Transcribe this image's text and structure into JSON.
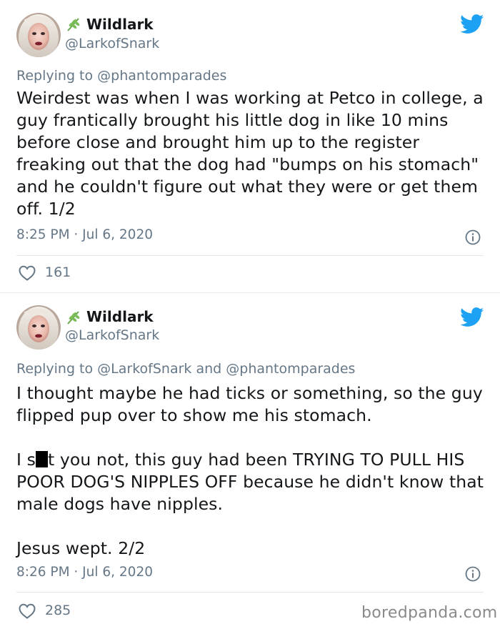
{
  "tweets": [
    {
      "author": {
        "name": "Wildlark",
        "handle": "@LarkofSnark"
      },
      "reply": {
        "prefix": "Replying to",
        "mentions": [
          "@phantomparades"
        ],
        "joiner": ""
      },
      "body": "Weirdest was when I was working at Petco in college, a guy frantically brought his little dog in like 10 mins before close and brought him up to the register freaking out that the dog had \"bumps on his stomach\" and he couldn't figure out what they were or get them off. 1/2",
      "timestamp": "8:25 PM · Jul 6, 2020",
      "likes": "161"
    },
    {
      "author": {
        "name": "Wildlark",
        "handle": "@LarkofSnark"
      },
      "reply": {
        "prefix": "Replying to",
        "mentions": [
          "@LarkofSnark",
          "@phantomparades"
        ],
        "joiner": "and"
      },
      "body_part1": "I thought maybe he had ticks or something, so the guy flipped pup over to show me his stomach.",
      "body_part2_before": "I s",
      "body_part2_after": "t you not, this guy had been TRYING TO PULL HIS POOR DOG'S NIPPLES OFF because he didn't know that male dogs have nipples.",
      "body_part3": "Jesus wept. 2/2",
      "timestamp": "8:26 PM · Jul 6, 2020",
      "likes": "285"
    }
  ],
  "watermark": "boredpanda.com",
  "colors": {
    "twitter_blue": "#1da1f2",
    "secondary_text": "#657786",
    "sprig_green": "#6aa84f"
  },
  "icons": {
    "bird": "twitter-bird-icon",
    "heart": "heart-icon",
    "info": "info-icon",
    "sprig": "herb-sprig-icon"
  }
}
